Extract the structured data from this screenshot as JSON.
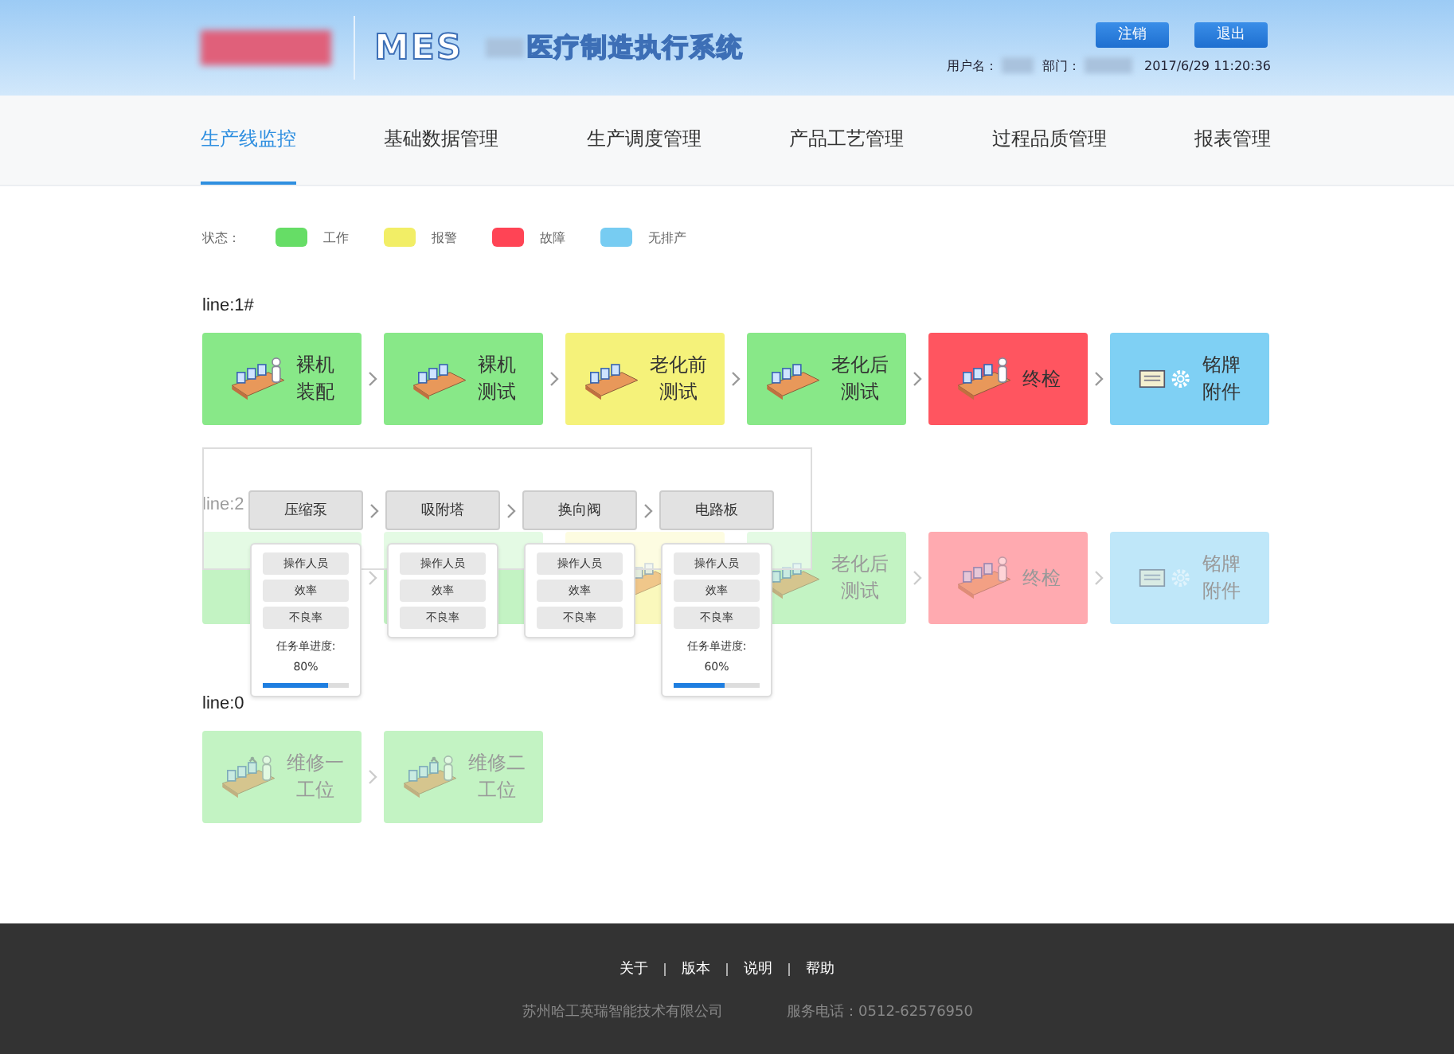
{
  "header": {
    "product": "MES",
    "system_title": "医疗制造执行系统",
    "buttons": [
      "注销",
      "退出"
    ],
    "user_label": "用户名：",
    "dept_label": "部门：",
    "datetime": "2017/6/29 11:20:36"
  },
  "nav": [
    {
      "label": "生产线监控",
      "selected": true
    },
    {
      "label": "基础数据管理",
      "selected": false
    },
    {
      "label": "生产调度管理",
      "selected": false
    },
    {
      "label": "产品工艺管理",
      "selected": false
    },
    {
      "label": "过程品质管理",
      "selected": false
    },
    {
      "label": "报表管理",
      "selected": false
    }
  ],
  "legend": {
    "label": "状态：",
    "items": [
      {
        "label": "工作",
        "color": "#66dd66"
      },
      {
        "label": "报警",
        "color": "#f2ee66"
      },
      {
        "label": "故障",
        "color": "#ff4455"
      },
      {
        "label": "无排产",
        "color": "#77ccf2"
      }
    ]
  },
  "lines": [
    {
      "label": "line:1#",
      "active": true,
      "stations": [
        {
          "text": [
            "裸机",
            "装配"
          ],
          "color": "#88e888",
          "kind": "assembly"
        },
        {
          "text": [
            "裸机",
            "测试"
          ],
          "color": "#88e888",
          "kind": "test"
        },
        {
          "text": [
            "老化前",
            "测试"
          ],
          "color": "#f5f27a",
          "kind": "test"
        },
        {
          "text": [
            "老化后",
            "测试"
          ],
          "color": "#88e888",
          "kind": "test"
        },
        {
          "text": [
            "终检"
          ],
          "color": "#ff5560",
          "kind": "inspect"
        },
        {
          "text": [
            "铭牌",
            "附件"
          ],
          "color": "#7fd0f4",
          "kind": "plate"
        }
      ]
    },
    {
      "label": "line:2",
      "active": false,
      "stations": [
        {
          "color": "#c3f3c3",
          "kind": "assembly"
        },
        {
          "color": "#c3f3c3",
          "kind": "test"
        },
        {
          "color": "#faf8bc",
          "kind": "test"
        },
        {
          "text": [
            "老化后",
            "测试"
          ],
          "color": "#c3f3c3",
          "kind": "test"
        },
        {
          "text": [
            "终检"
          ],
          "color": "#ffaab0",
          "kind": "inspect"
        },
        {
          "text": [
            "铭牌",
            "附件"
          ],
          "color": "#bfe7f9",
          "kind": "plate"
        }
      ]
    },
    {
      "label": "line:0",
      "active": false,
      "stations": [
        {
          "text": [
            "维修一",
            "工位"
          ],
          "color": "#c3f3c3",
          "kind": "repair"
        },
        {
          "text": [
            "维修二",
            "工位"
          ],
          "color": "#c3f3c3",
          "kind": "repair"
        }
      ]
    }
  ],
  "popover": {
    "steps": [
      {
        "label": "压缩泵",
        "details": [
          "操作人员",
          "效率",
          "不良率"
        ],
        "progress_label": "任务单进度:",
        "progress_value": "80%",
        "level": 0.75
      },
      {
        "label": "吸附塔",
        "details": [
          "操作人员",
          "效率",
          "不良率"
        ]
      },
      {
        "label": "换向阀",
        "details": [
          "操作人员",
          "效率",
          "不良率"
        ]
      },
      {
        "label": "电路板",
        "details": [
          "操作人员",
          "效率",
          "不良率"
        ],
        "progress_label": "任务单进度:",
        "progress_value": "60%",
        "level": 0.6
      }
    ]
  },
  "footer": {
    "links": [
      "关于",
      "版本",
      "说明",
      "帮助"
    ],
    "company": "苏州哈工英瑞智能技术有限公司",
    "phone": "服务电话：0512-62576950"
  }
}
